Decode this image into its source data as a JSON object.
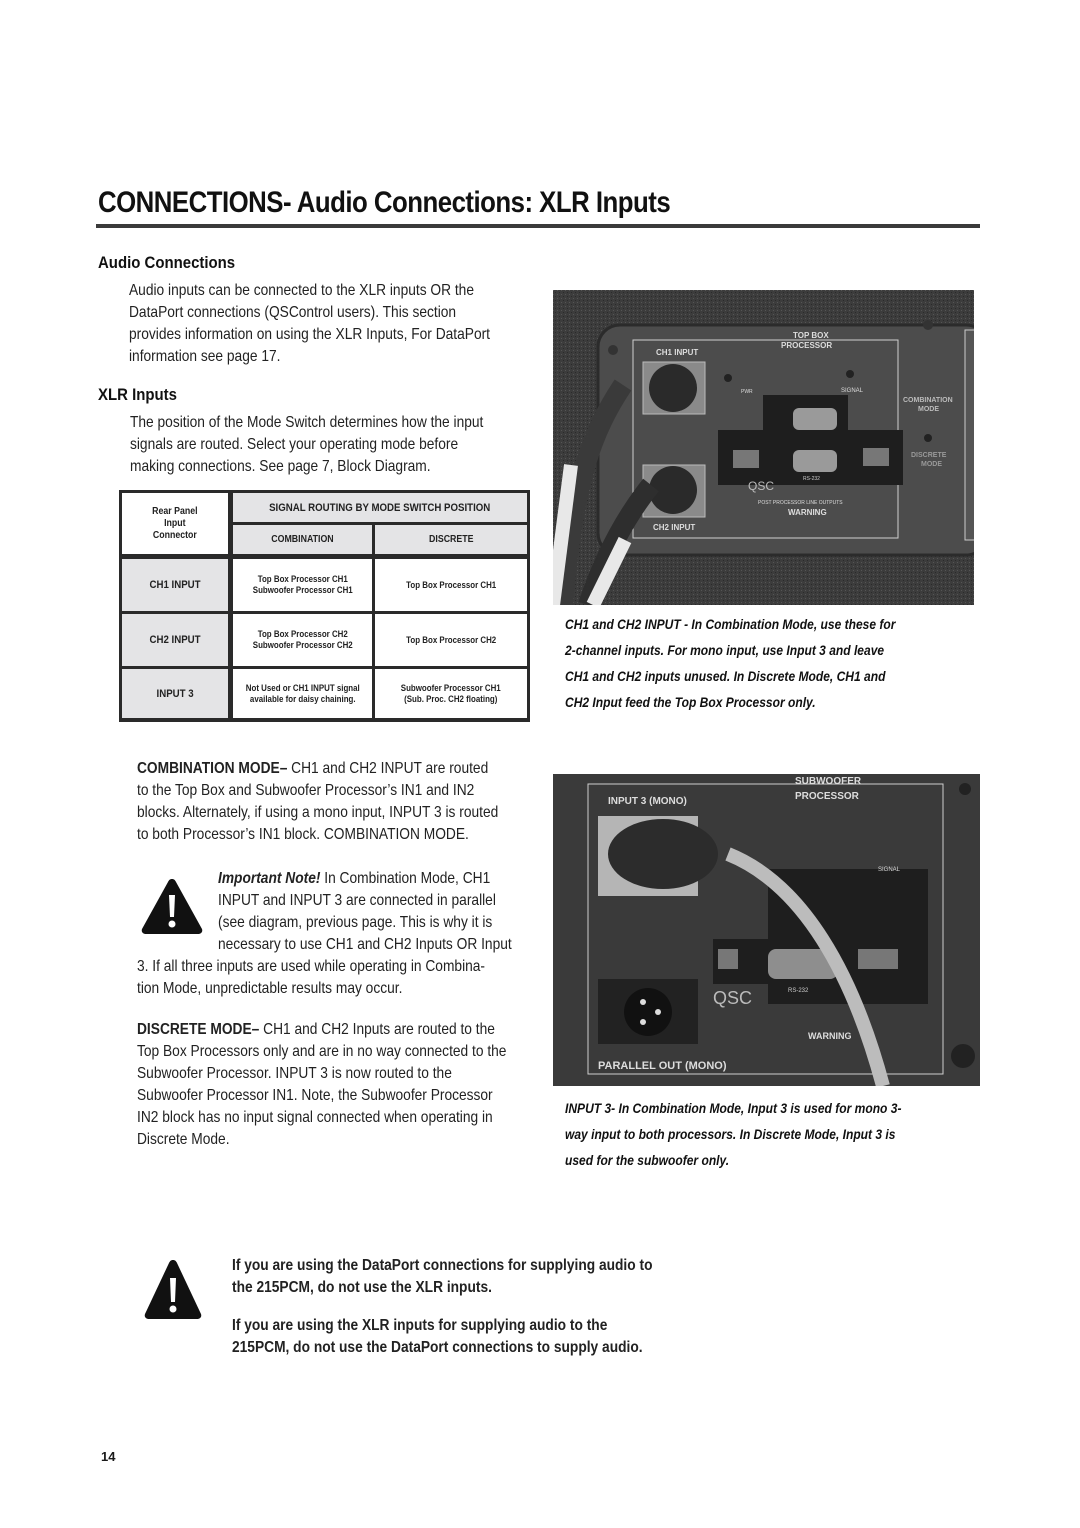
{
  "page": {
    "title": "CONNECTIONS- Audio Connections: XLR Inputs",
    "page_number": "14"
  },
  "audio_connections": {
    "heading": "Audio Connections",
    "lines": [
      "Audio inputs can be connected to the XLR inputs OR the",
      "DataPort connections (QSControl users). This section",
      "provides information on using the XLR Inputs, For DataPort",
      "information see page 17."
    ]
  },
  "xlr_inputs": {
    "heading": "XLR Inputs",
    "lines": [
      "The position of the Mode Switch determines how the input",
      "signals are routed. Select your operating mode before",
      "making connections. See page 7, Block Diagram."
    ]
  },
  "routing_table": {
    "corner_header": [
      "Rear Panel",
      "Input",
      "Connector"
    ],
    "group_header": "SIGNAL ROUTING BY MODE SWITCH POSITION",
    "columns": [
      "COMBINATION",
      "DISCRETE"
    ],
    "rows": [
      {
        "connector": "CH1 INPUT",
        "combination": [
          "Top Box Processor CH1",
          "Subwoofer Processor CH1"
        ],
        "discrete": [
          "Top Box Processor CH1"
        ]
      },
      {
        "connector": "CH2 INPUT",
        "combination": [
          "Top Box Processor CH2",
          "Subwoofer Processor CH2"
        ],
        "discrete": [
          "Top Box Processor CH2"
        ]
      },
      {
        "connector": "INPUT 3",
        "combination": [
          "Not Used or CH1 INPUT signal",
          "available for daisy chaining."
        ],
        "discrete": [
          "Subwoofer Processor CH1",
          "(Sub. Proc. CH2 floating)"
        ]
      }
    ]
  },
  "combination_mode": {
    "label": "COMBINATION MODE",
    "dash": "– ",
    "lines": [
      "CH1 and CH2 INPUT are routed",
      "to the Top Box and Subwoofer Processor’s IN1 and IN2",
      "blocks. Alternately, if using a mono input, INPUT 3 is routed",
      "to both Processor’s IN1 block. COMBINATION MODE."
    ]
  },
  "important_note": {
    "label": "Important Note!",
    "lines": [
      " In Combination Mode, CH1",
      "INPUT and INPUT 3 are connected in parallel",
      "(see diagram, previous page. This is why it is",
      "necessary to use CH1 and CH2 Inputs OR Input",
      "3. If all three inputs are used while operating in Combina-",
      "tion Mode, unpredictable results may occur."
    ]
  },
  "discrete_mode": {
    "label": "DISCRETE MODE",
    "dash": "– ",
    "lines": [
      "CH1 and CH2 Inputs are routed to the",
      "Top Box Processors only and are in no way connected to the",
      "Subwoofer Processor. INPUT 3 is now routed to the",
      "Subwoofer Processor IN1. Note, the Subwoofer Processor",
      "IN2 block has no input signal connected when operating in",
      "Discrete Mode."
    ]
  },
  "photo_top": {
    "labels": {
      "ch1": "CH1 INPUT",
      "ch2": "CH2 INPUT",
      "processor": [
        "TOP BOX",
        "PROCESSOR"
      ],
      "pwr": "PWR",
      "signal": "SIGNAL",
      "combination": [
        "COMBINATION",
        "MODE"
      ],
      "discrete": [
        "DISCRETE",
        "MODE"
      ],
      "rs232": "RS-232",
      "post": "POST PROCESSOR LINE OUTPUTS",
      "warning": "WARNING",
      "logo": "QSC"
    },
    "caption": [
      "CH1 and CH2 INPUT - In Combination Mode, use these for",
      "2-channel inputs. For mono input, use Input 3 and leave",
      "CH1 and CH2 inputs unused. In Discrete Mode, CH1 and",
      "CH2 Input feed the Top Box Processor only."
    ]
  },
  "photo_bottom": {
    "labels": {
      "input3": "INPUT 3 (MONO)",
      "processor": [
        "SUBWOOFER",
        "PROCESSOR"
      ],
      "signal": "SIGNAL",
      "parallel": "PARALLEL OUT (MONO)",
      "rs232": "RS-232",
      "warning": "WARNING",
      "logo": "QSC"
    },
    "caption": [
      "INPUT 3-  In Combination Mode, Input 3 is used for mono 3-",
      "way input to both processors. In Discrete Mode, Input 3 is",
      "used for the subwoofer only."
    ]
  },
  "dataport_warning": {
    "lines_1": [
      "If you are using the DataPort connections for supplying audio to",
      "the 215PCM, do not use the XLR inputs."
    ],
    "lines_2": [
      "If you are using the XLR inputs for supplying audio to the",
      "215PCM, do not use the DataPort connections to supply audio."
    ]
  }
}
